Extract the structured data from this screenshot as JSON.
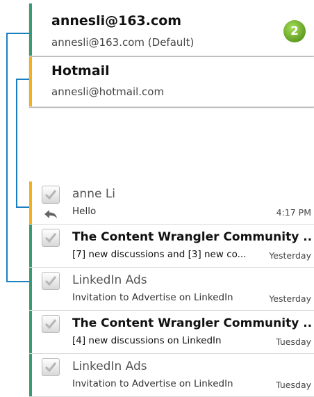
{
  "colors": {
    "account1": "#3a9a72",
    "account2": "#f2b01e",
    "connector": "#1a7fc0"
  },
  "accounts": [
    {
      "name": "annesli@163.com",
      "address": "annesli@163.com (Default)",
      "unread_count": "2"
    },
    {
      "name": "Hotmail",
      "address": "annesli@hotmail.com"
    }
  ],
  "messages": [
    {
      "sender": "anne Li",
      "subject": "Hello",
      "date": "4:17 PM",
      "account": "hotmail",
      "read": true,
      "replied": true
    },
    {
      "sender": "The Content Wrangler Community ...",
      "subject": "[7] new discussions and [3] new co...",
      "date": "Yesterday",
      "account": "163",
      "read": false
    },
    {
      "sender": "LinkedIn Ads",
      "subject": "Invitation to Advertise on LinkedIn",
      "date": "Yesterday",
      "account": "163",
      "read": true
    },
    {
      "sender": "The Content Wrangler Community ...",
      "subject": "[4] new discussions on LinkedIn",
      "date": "Tuesday",
      "account": "163",
      "read": false
    },
    {
      "sender": "LinkedIn Ads",
      "subject": "Invitation to Advertise on LinkedIn",
      "date": "Tuesday",
      "account": "163",
      "read": true
    }
  ]
}
